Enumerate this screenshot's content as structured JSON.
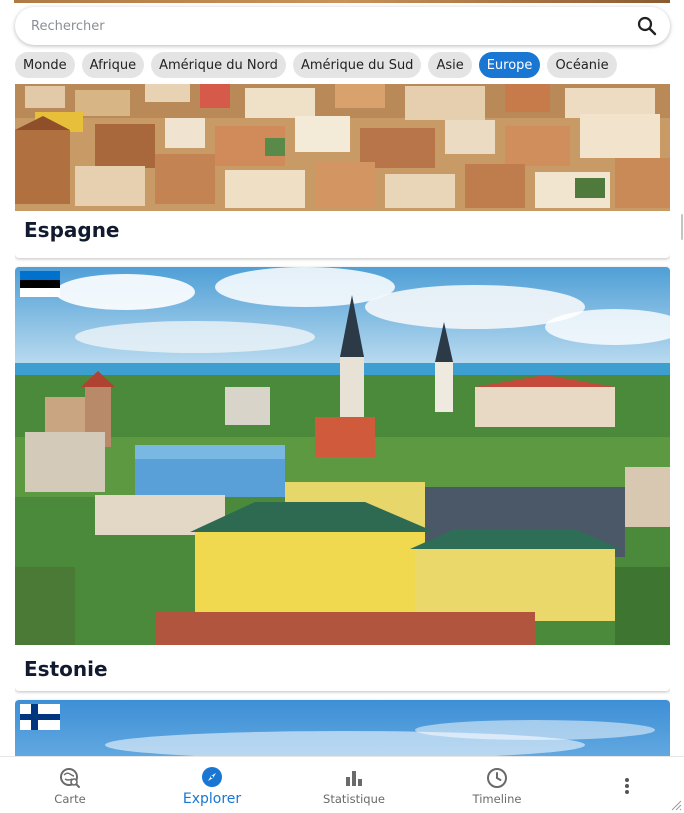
{
  "search": {
    "placeholder": "Rechercher"
  },
  "filters": [
    {
      "label": "Monde",
      "active": false
    },
    {
      "label": "Afrique",
      "active": false
    },
    {
      "label": "Amérique du Nord",
      "active": false
    },
    {
      "label": "Amérique du Sud",
      "active": false
    },
    {
      "label": "Asie",
      "active": false
    },
    {
      "label": "Europe",
      "active": true
    },
    {
      "label": "Océanie",
      "active": false
    }
  ],
  "countries": [
    {
      "name": "Espagne"
    },
    {
      "name": "Estonie",
      "flag": "estonia-flag"
    },
    {
      "name": "",
      "flag": "finland-flag"
    }
  ],
  "nav": {
    "items": [
      {
        "label": "Carte",
        "icon": "map-search-icon"
      },
      {
        "label": "Explorer",
        "icon": "compass-icon",
        "active": true
      },
      {
        "label": "Statistique",
        "icon": "bar-chart-icon"
      },
      {
        "label": "Timeline",
        "icon": "clock-icon"
      }
    ],
    "more_icon": "more-vertical-icon"
  },
  "colors": {
    "accent": "#1976d2",
    "chip": "#e4e4e4",
    "title": "#111a2e"
  }
}
